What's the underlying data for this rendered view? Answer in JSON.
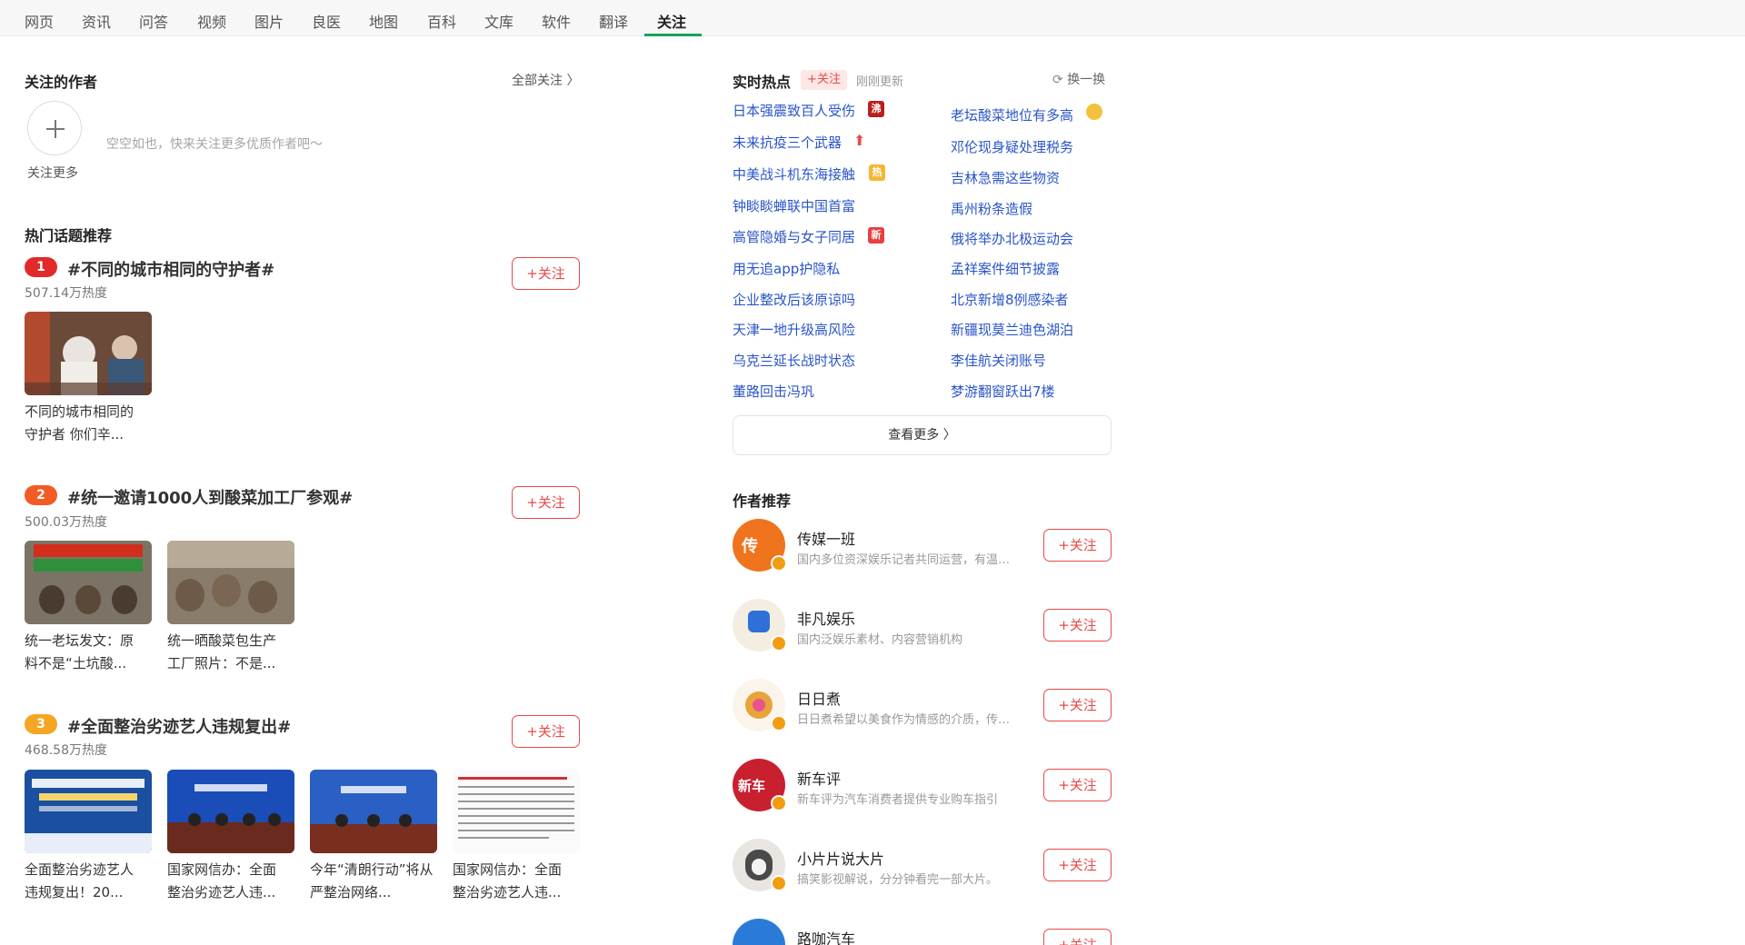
{
  "nav": {
    "tabs": [
      "网页",
      "资讯",
      "问答",
      "视频",
      "图片",
      "良医",
      "地图",
      "百科",
      "文库",
      "软件",
      "翻译",
      "关注"
    ],
    "active": "关注"
  },
  "followed_authors": {
    "title": "关注的作者",
    "all_link": "全部关注 〉",
    "add_more": "关注更多",
    "empty_hint": "空空如也，快来关注更多优质作者吧～"
  },
  "hot_topics": {
    "title": "热门话题推荐",
    "follow_label": "+关注",
    "items": [
      {
        "rank": "1",
        "title": "#不同的城市相同的守护者#",
        "heat": "507.14万热度",
        "posts": [
          {
            "caption1": "不同的城市相同的",
            "caption2": "守护者 你们辛..."
          }
        ]
      },
      {
        "rank": "2",
        "title": "#统一邀请1000人到酸菜加工厂参观#",
        "heat": "500.03万热度",
        "posts": [
          {
            "caption1": "统一老坛发文：原",
            "caption2": "料不是“土坑酸..."
          },
          {
            "caption1": "统一晒酸菜包生产",
            "caption2": "工厂照片：不是..."
          }
        ]
      },
      {
        "rank": "3",
        "title": "#全面整治劣迹艺人违规复出#",
        "heat": "468.58万热度",
        "posts": [
          {
            "caption1": "全面整治劣迹艺人",
            "caption2": "违规复出！20..."
          },
          {
            "caption1": "国家网信办：全面",
            "caption2": "整治劣迹艺人违..."
          },
          {
            "caption1": "今年“清朗行动”将从",
            "caption2": "严整治网络..."
          },
          {
            "caption1": "国家网信办：全面",
            "caption2": "整治劣迹艺人违..."
          }
        ]
      }
    ]
  },
  "realtime": {
    "title": "实时热点",
    "follow_badge": "+关注",
    "updated": "刚刚更新",
    "refresh": "换一换",
    "left": [
      "日本强震致百人受伤",
      "未来抗疫三个武器",
      "中美战斗机东海接触",
      "钟睒睒蝉联中国首富",
      "高管隐婚与女子同居",
      "用无追app护隐私",
      "企业整改后该原谅吗",
      "天津一地升级高风险",
      "乌克兰延长战时状态",
      "董路回击冯巩"
    ],
    "right": [
      "老坛酸菜地位有多高",
      "邓伦现身疑处理税务",
      "吉林急需这些物资",
      "禹州粉条造假",
      "俄将举办北极运动会",
      "孟祥案件细节披露",
      "北京新增8例感染者",
      "新疆现莫兰迪色湖泊",
      "李佳航关闭账号",
      "梦游翻窗跃出7楼"
    ],
    "tags": {
      "boil": "沸",
      "hot": "热",
      "new": "新"
    },
    "more": "查看更多 〉"
  },
  "author_rec": {
    "title": "作者推荐",
    "follow_label": "+关注",
    "items": [
      {
        "name": "传媒一班",
        "desc": "国内多位资深娱乐记者共同运营，有温度的娱乐内容",
        "color": "#f0731e"
      },
      {
        "name": "非凡娱乐",
        "desc": "国内泛娱乐素材、内容营销机构",
        "color": "#2f6fd8"
      },
      {
        "name": "日日煮",
        "desc": "日日煮希望以美食作为情感的介质，传递生活的美好",
        "color": "#e7a43b"
      },
      {
        "name": "新车评",
        "desc": "新车评为汽车消费者提供专业购车指引",
        "color": "#c8202f"
      },
      {
        "name": "小片片说大片",
        "desc": "搞笑影视解说，分分钟看完一部大片。",
        "color": "#6b6b6b"
      },
      {
        "name": "路咖汽车",
        "desc": "",
        "color": "#2a7bd8"
      }
    ]
  }
}
